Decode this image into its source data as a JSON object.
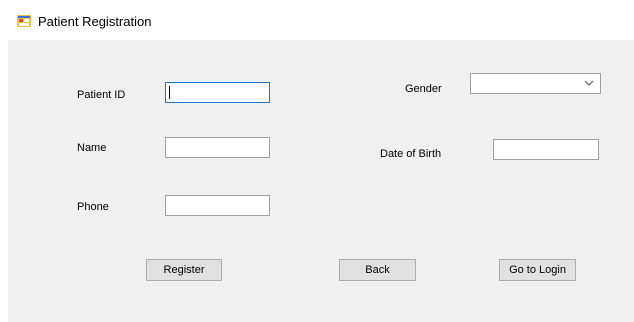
{
  "window": {
    "title": "Patient Registration",
    "icon": "form-window-icon"
  },
  "form": {
    "patient_id_label": "Patient ID",
    "patient_id_value": "",
    "name_label": "Name",
    "name_value": "",
    "phone_label": "Phone",
    "phone_value": "",
    "gender_label": "Gender",
    "gender_selected": "",
    "dob_label": "Date of Birth",
    "dob_value": ""
  },
  "buttons": {
    "register": "Register",
    "back": "Back",
    "go_to_login": "Go to Login"
  },
  "colors": {
    "focus_border": "#1a73c8",
    "client_background": "#f0f0f0",
    "button_face": "#e1e1e1"
  }
}
